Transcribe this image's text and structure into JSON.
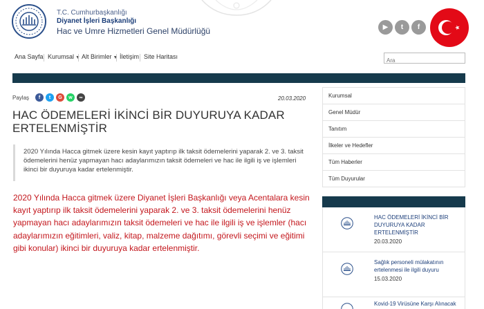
{
  "header": {
    "line1": "T.C. Cumhurbaşkanlığı",
    "line2": "Diyanet İşleri Başkanlığı",
    "line3": "Hac ve Umre Hizmetleri Genel Müdürlüğü",
    "social": [
      {
        "icon": "youtube-icon",
        "glyph": "▶"
      },
      {
        "icon": "twitter-icon",
        "glyph": "t"
      },
      {
        "icon": "facebook-icon",
        "glyph": "f"
      }
    ]
  },
  "nav": {
    "items": [
      "Ana Sayfa",
      "Kurumsal",
      "Alt Birimler",
      "İletişim",
      "Site Haritası"
    ],
    "search_placeholder": "Ara"
  },
  "article": {
    "share_label": "Paylaş",
    "date": "20.03.2020",
    "title": "HAC ÖDEMELERİ İKİNCİ BİR DUYURUYA KADAR ERTELENMİŞTİR",
    "summary": "2020 Yılında Hacca gitmek üzere kesin kayıt yaptırıp ilk taksit ödemelerini yaparak 2. ve 3. taksit ödemelerini henüz yapmayan hacı adaylarımızın taksit ödemeleri ve hac ile ilgili iş ve işlemleri ikinci bir duyuruya kadar ertelenmiştir.",
    "body": "2020 Yılında Hacca gitmek üzere Diyanet İşleri Başkanlığı veya Acentalara kesin kayıt yaptırıp ilk taksit ödemelerini yaparak 2. ve 3. taksit ödemelerini henüz yapmayan hacı adaylarımızın taksit ödemeleri ve hac ile ilgili iş ve işlemler (hacı adaylarımızın eğitimleri, valiz, kitap, malzeme dağıtımı, görevli seçimi ve eğitimi gibi konular) ikinci bir duyuruya kadar ertelenmiştir."
  },
  "sidebar": {
    "menu": [
      "Kurumsal",
      "Genel Müdür",
      "Tanıtım",
      "İlkeler ve Hedefler",
      "Tüm Haberler",
      "Tüm Duyurular"
    ],
    "news": [
      {
        "title": "HAC ÖDEMELERİ İKİNCİ BİR DUYURUYA KADAR ERTELENMİŞTİR",
        "date": "20.03.2020"
      },
      {
        "title": "Sağlık personeli mülakatının ertelenmesi ile ilgili duyuru",
        "date": "15.03.2020"
      },
      {
        "title": "Kovid-19 Virüsüne Karşı Alınacak",
        "date": ""
      }
    ]
  }
}
